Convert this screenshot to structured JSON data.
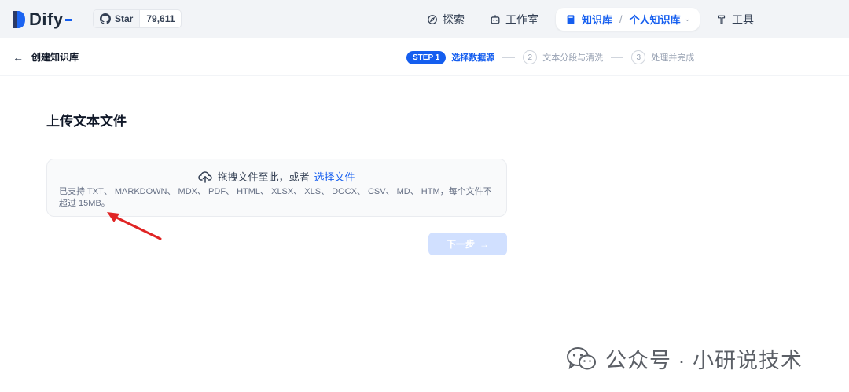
{
  "app": {
    "name": "Dify"
  },
  "github": {
    "star_label": "Star",
    "star_count": "79,611"
  },
  "nav": {
    "explore": "探索",
    "studio": "工作室",
    "knowledge": "知识库",
    "knowledge_sub": "个人知识库",
    "tools": "工具"
  },
  "subheader": {
    "back_label": "创建知识库",
    "steps": {
      "step1_pill": "STEP 1",
      "step1_label": "选择数据源",
      "step2_num": "2",
      "step2_label": "文本分段与清洗",
      "step3_num": "3",
      "step3_label": "处理并完成"
    }
  },
  "main": {
    "title": "上传文本文件",
    "dropzone": {
      "prompt": "拖拽文件至此，或者",
      "link": "选择文件",
      "support_text": "已支持 TXT、 MARKDOWN、 MDX、 PDF、 HTML、 XLSX、 XLS、 DOCX、 CSV、 MD、 HTM，每个文件不超过 15MB。"
    },
    "next_button": "下一步"
  },
  "watermark": {
    "text": "公众号 · 小研说技术"
  },
  "colors": {
    "accent": "#155eef",
    "nav_bg": "#f2f4f7",
    "annotation_red": "#e02424"
  }
}
